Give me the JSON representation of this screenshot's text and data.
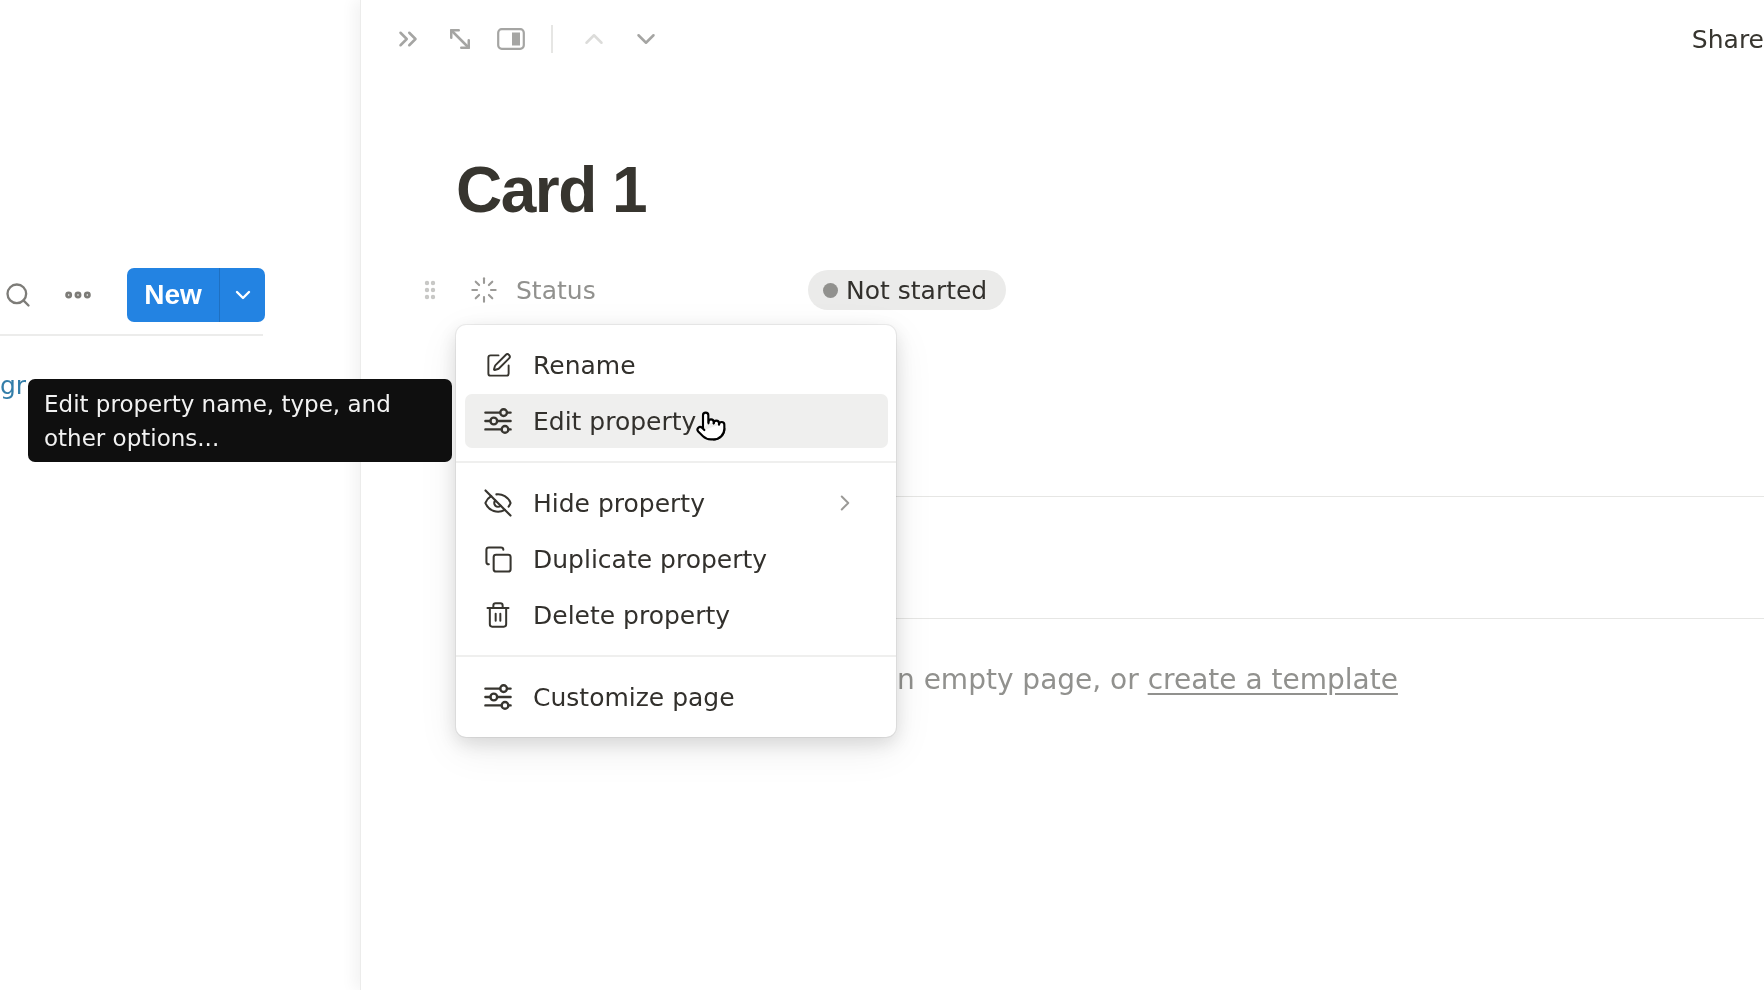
{
  "sidebar": {
    "new_button": "New",
    "link_text": "gr"
  },
  "tooltip": "Edit property name, type, and other options...",
  "topbar": {
    "page_nav": {
      "previous_disabled": true,
      "next_disabled": false
    },
    "share": "Share"
  },
  "page": {
    "title": "Card 1",
    "properties": [
      {
        "name": "Status",
        "value": "Not started",
        "color": "#91918e"
      }
    ],
    "empty_hint": {
      "text": "n empty page, or",
      "link": "create a template"
    }
  },
  "menu": {
    "groups": [
      {
        "items": [
          {
            "kind": "rename",
            "label": "Rename",
            "selected": false,
            "submenu": false
          },
          {
            "kind": "edit",
            "label": "Edit property",
            "selected": true,
            "submenu": false
          }
        ]
      },
      {
        "items": [
          {
            "kind": "hide",
            "label": "Hide property",
            "selected": false,
            "submenu": true
          },
          {
            "kind": "duplicate",
            "label": "Duplicate property",
            "selected": false,
            "submenu": false
          },
          {
            "kind": "delete",
            "label": "Delete property",
            "selected": false,
            "submenu": false
          }
        ]
      },
      {
        "items": [
          {
            "kind": "customize",
            "label": "Customize page",
            "selected": false,
            "submenu": false
          }
        ]
      }
    ]
  }
}
